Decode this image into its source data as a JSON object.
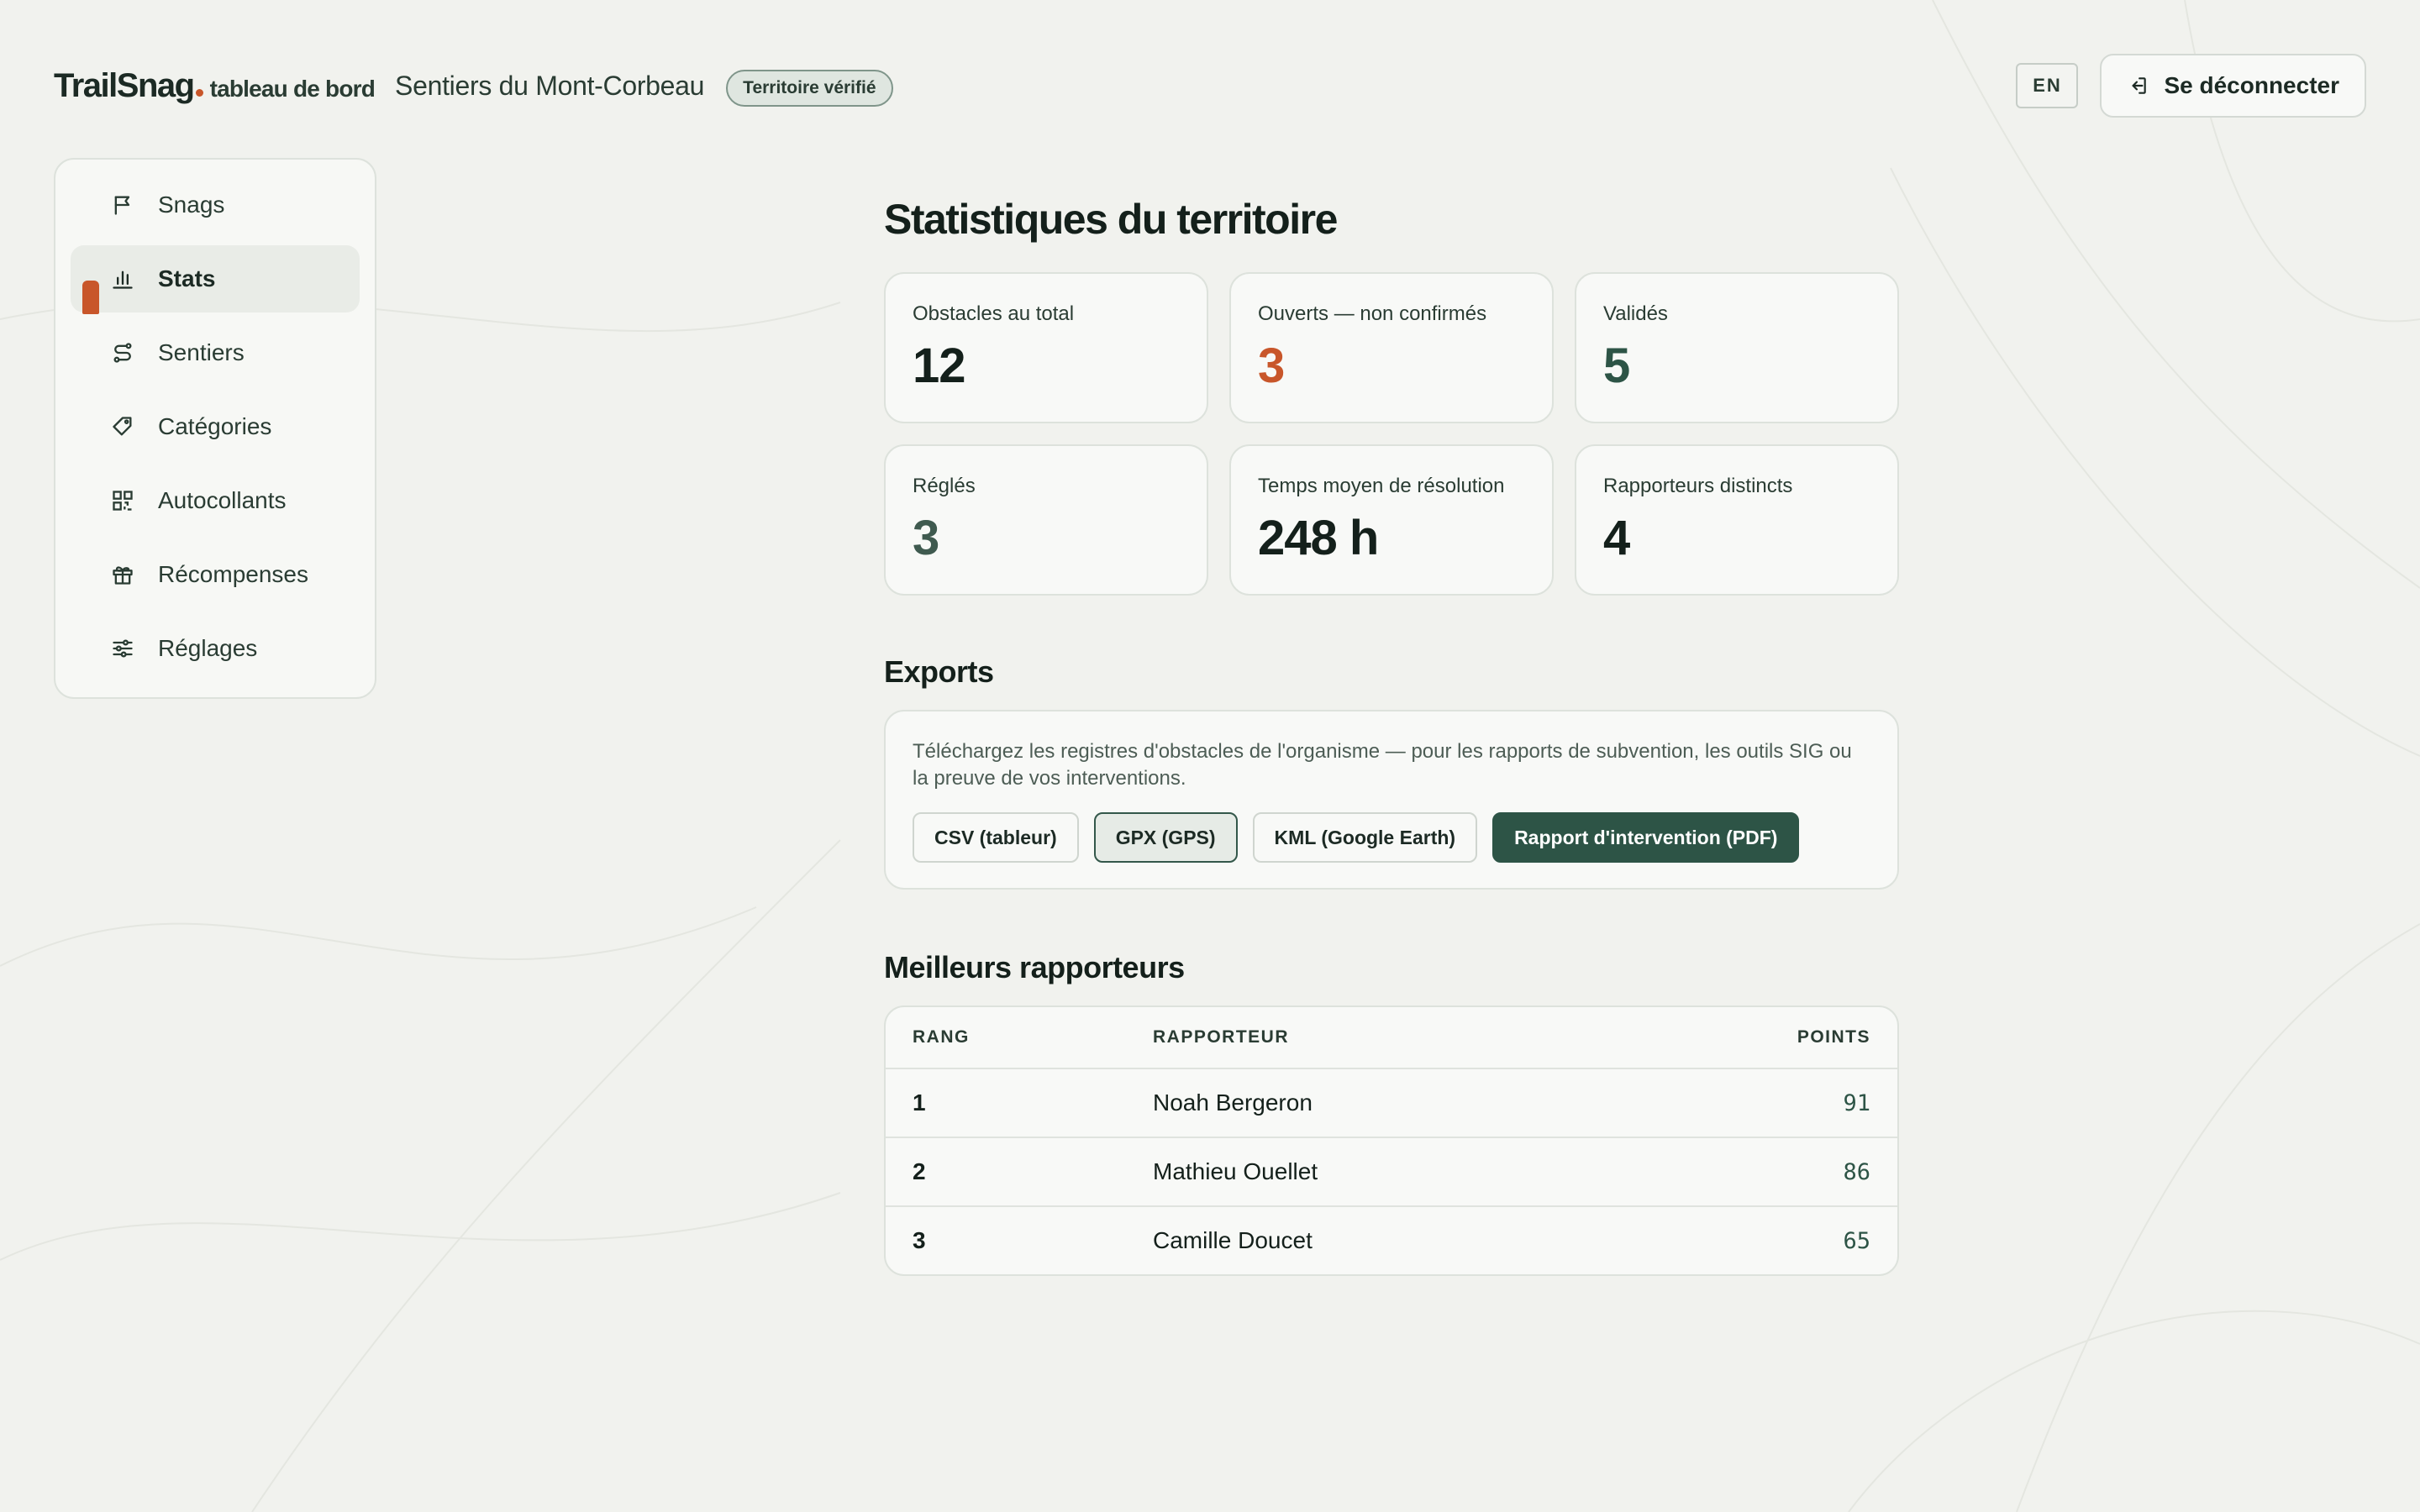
{
  "header": {
    "logo_text": "TrailSnag",
    "logo_subtitle": "tableau de bord",
    "territory_name": "Sentiers du Mont-Corbeau",
    "verified_badge": "Territoire vérifié",
    "language_button": "EN",
    "logout_label": "Se déconnecter"
  },
  "sidebar": {
    "items": [
      {
        "label": "Snags",
        "icon": "flag-icon"
      },
      {
        "label": "Stats",
        "icon": "bar-chart-icon",
        "active": true
      },
      {
        "label": "Sentiers",
        "icon": "route-icon"
      },
      {
        "label": "Catégories",
        "icon": "tag-icon"
      },
      {
        "label": "Autocollants",
        "icon": "qr-code-icon"
      },
      {
        "label": "Récompenses",
        "icon": "gift-icon"
      },
      {
        "label": "Réglages",
        "icon": "sliders-icon"
      }
    ]
  },
  "main": {
    "title": "Statistiques du territoire",
    "stats": [
      {
        "label": "Obstacles au total",
        "value": "12",
        "color": "#14201b"
      },
      {
        "label": "Ouverts — non confirmés",
        "value": "3",
        "color": "#c8562a"
      },
      {
        "label": "Validés",
        "value": "5",
        "color": "#2d5446"
      },
      {
        "label": "Réglés",
        "value": "3",
        "color": "#3f5a4f"
      },
      {
        "label": "Temps moyen de résolution",
        "value": "248 h",
        "color": "#14201b"
      },
      {
        "label": "Rapporteurs distincts",
        "value": "4",
        "color": "#14201b"
      }
    ],
    "exports": {
      "title": "Exports",
      "description": "Téléchargez les registres d'obstacles de l'organisme — pour les rapports de subvention, les outils SIG ou la preuve de vos interventions.",
      "buttons": [
        "CSV (tableur)",
        "GPX (GPS)",
        "KML (Google Earth)",
        "Rapport d'intervention (PDF)"
      ]
    },
    "top_reporters": {
      "title": "Meilleurs rapporteurs",
      "columns": [
        "RANG",
        "RAPPORTEUR",
        "POINTS"
      ],
      "rows": [
        {
          "rank": "1",
          "name": "Noah Bergeron",
          "points": "91"
        },
        {
          "rank": "2",
          "name": "Mathieu Ouellet",
          "points": "86"
        },
        {
          "rank": "3",
          "name": "Camille Doucet",
          "points": "65"
        }
      ]
    }
  },
  "colors": {
    "accent": "#c8562a",
    "primary": "#2d5446",
    "background": "#f1f2ee"
  }
}
